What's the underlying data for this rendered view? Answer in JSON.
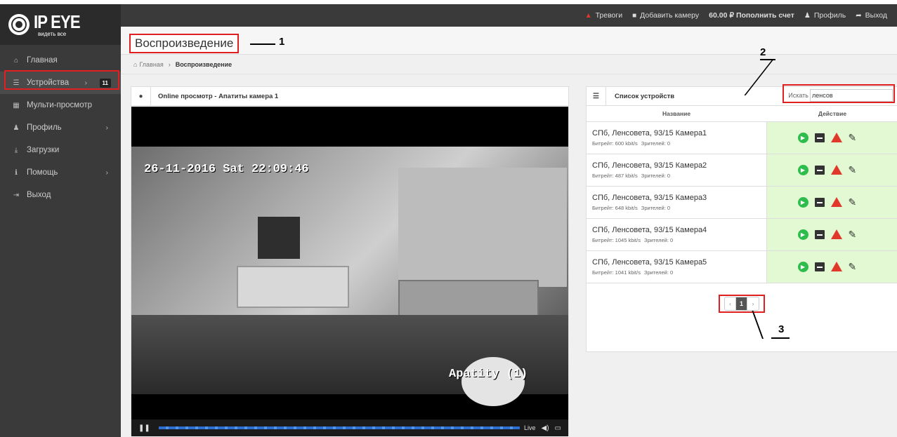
{
  "logo": {
    "main": "IP EYE",
    "sub": "видеть все"
  },
  "sidebar": {
    "items": [
      {
        "icon": "home-icon",
        "glyph": "⌂",
        "label": "Главная"
      },
      {
        "icon": "list-icon",
        "glyph": "☰",
        "label": "Устройства",
        "chev": "›",
        "badge": "11"
      },
      {
        "icon": "grid-icon",
        "glyph": "▦",
        "label": "Мульти-просмотр"
      },
      {
        "icon": "user-icon",
        "glyph": "♟",
        "label": "Профиль",
        "chev": "›"
      },
      {
        "icon": "download-icon",
        "glyph": "⤓",
        "label": "Загрузки"
      },
      {
        "icon": "info-icon",
        "glyph": "ℹ",
        "label": "Помощь",
        "chev": "›"
      },
      {
        "icon": "logout-icon",
        "glyph": "⇥",
        "label": "Выход"
      }
    ]
  },
  "topbar": {
    "alerts": "Тревоги",
    "add_camera": "Добавить камеру",
    "balance": "60.00 ₽ Пополнить счет",
    "profile": "Профиль",
    "logout": "Выход"
  },
  "page": {
    "title": "Воспроизведение"
  },
  "breadcrumb": {
    "home": "Главная",
    "sep": "›",
    "current": "Воспроизведение"
  },
  "video": {
    "title": "Online просмотр - Апатиты камера 1",
    "osd_date": "26-11-2016 Sat 22:09:46",
    "osd_name": "Apatity (1)",
    "live": "Live",
    "progress": 1.0
  },
  "devices": {
    "title": "Список устройств",
    "search_label": "Искать",
    "search_value": "ленсов",
    "col_name": "Название",
    "col_action": "Действие",
    "rows": [
      {
        "name": "СПб, Ленсовета, 93/15 Камера1",
        "bitrate": "Битрейт: 600 kbit/s",
        "viewers": "Зрителей: 0"
      },
      {
        "name": "СПб, Ленсовета, 93/15 Камера2",
        "bitrate": "Битрейт: 487 kbit/s",
        "viewers": "Зрителей: 0"
      },
      {
        "name": "СПб, Ленсовета, 93/15 Камера3",
        "bitrate": "Битрейт: 648 kbit/s",
        "viewers": "Зрителей: 0"
      },
      {
        "name": "СПб, Ленсовета, 93/15 Камера4",
        "bitrate": "Битрейт: 1045 kbit/s",
        "viewers": "Зрителей: 0"
      },
      {
        "name": "СПб, Ленсовета, 93/15 Камера5",
        "bitrate": "Битрейт: 1041 kbit/s",
        "viewers": "Зрителей: 0"
      }
    ],
    "pager": {
      "prev": "‹",
      "page": "1",
      "next": "›"
    }
  },
  "annotations": {
    "n1": "1",
    "n2": "2",
    "n3": "3"
  },
  "colors": {
    "sidebar": "#3a3a3a",
    "annotation": "#e02020",
    "action_bg": "#e2f9d3",
    "play": "#2ebd4c",
    "alert": "#e0392b"
  }
}
